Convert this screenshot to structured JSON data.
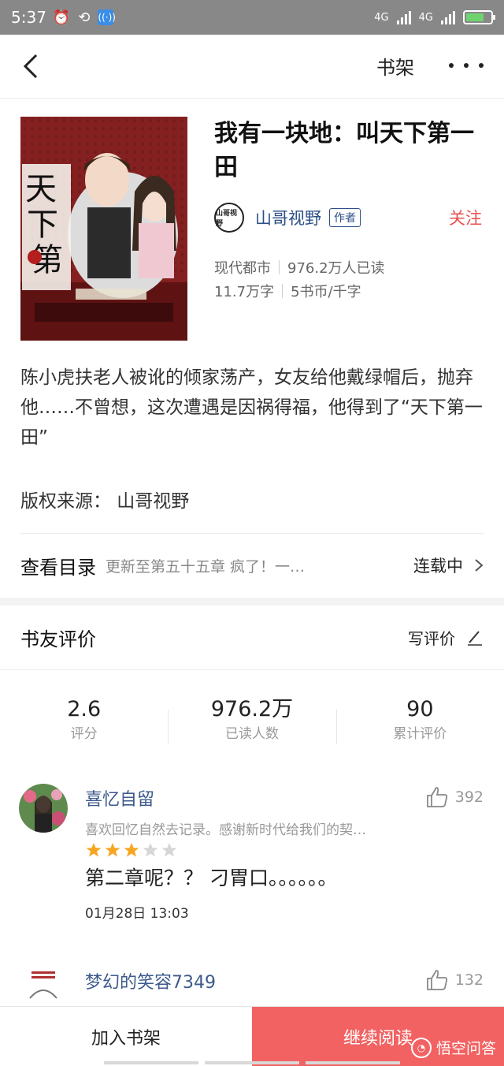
{
  "status_bar": {
    "time": "5:37",
    "network_1": "4G",
    "network_2": "4G"
  },
  "nav": {
    "shelf_label": "书架"
  },
  "book": {
    "title": "我有一块地：叫天下第一田",
    "author_avatar_text": "山哥视野",
    "author": "山哥视野",
    "author_tag": "作者",
    "follow_label": "关注",
    "category": "现代都市",
    "readers": "976.2万人已读",
    "word_count": "11.7万字",
    "price": "5书币/千字",
    "description": "陈小虎扶老人被讹的倾家荡产，女友给他戴绿帽后，抛弃他……不曾想，这次遭遇是因祸得福，他得到了“天下第一田”",
    "copyright": "版权来源：  山哥视野"
  },
  "catalog": {
    "label": "查看目录",
    "latest": "更新至第五十五章 疯了！一…",
    "status": "连载中"
  },
  "reviews_header": {
    "title": "书友评价",
    "write_label": "写评价"
  },
  "stats": [
    {
      "value": "2.6",
      "label": "评分"
    },
    {
      "value": "976.2万",
      "label": "已读人数"
    },
    {
      "value": "90",
      "label": "累计评价"
    }
  ],
  "comments": [
    {
      "name": "喜忆自留",
      "likes": "392",
      "bio": "喜欢回忆自然去记录。感谢新时代给我们的契…",
      "rating": 3,
      "text": "第二章呢？？ 刁胃口。。。。。。",
      "date": "01月28日 13:03"
    },
    {
      "name": "梦幻的笑容7349",
      "likes": "132"
    }
  ],
  "bottom_bar": {
    "add_label": "加入书架",
    "continue_label": "继续阅读"
  },
  "watermark": {
    "text": "悟空问答"
  },
  "colors": {
    "accent_red": "#f26262",
    "follow_red": "#e85050",
    "link_blue": "#3d5a8c",
    "star": "#f6a623"
  }
}
